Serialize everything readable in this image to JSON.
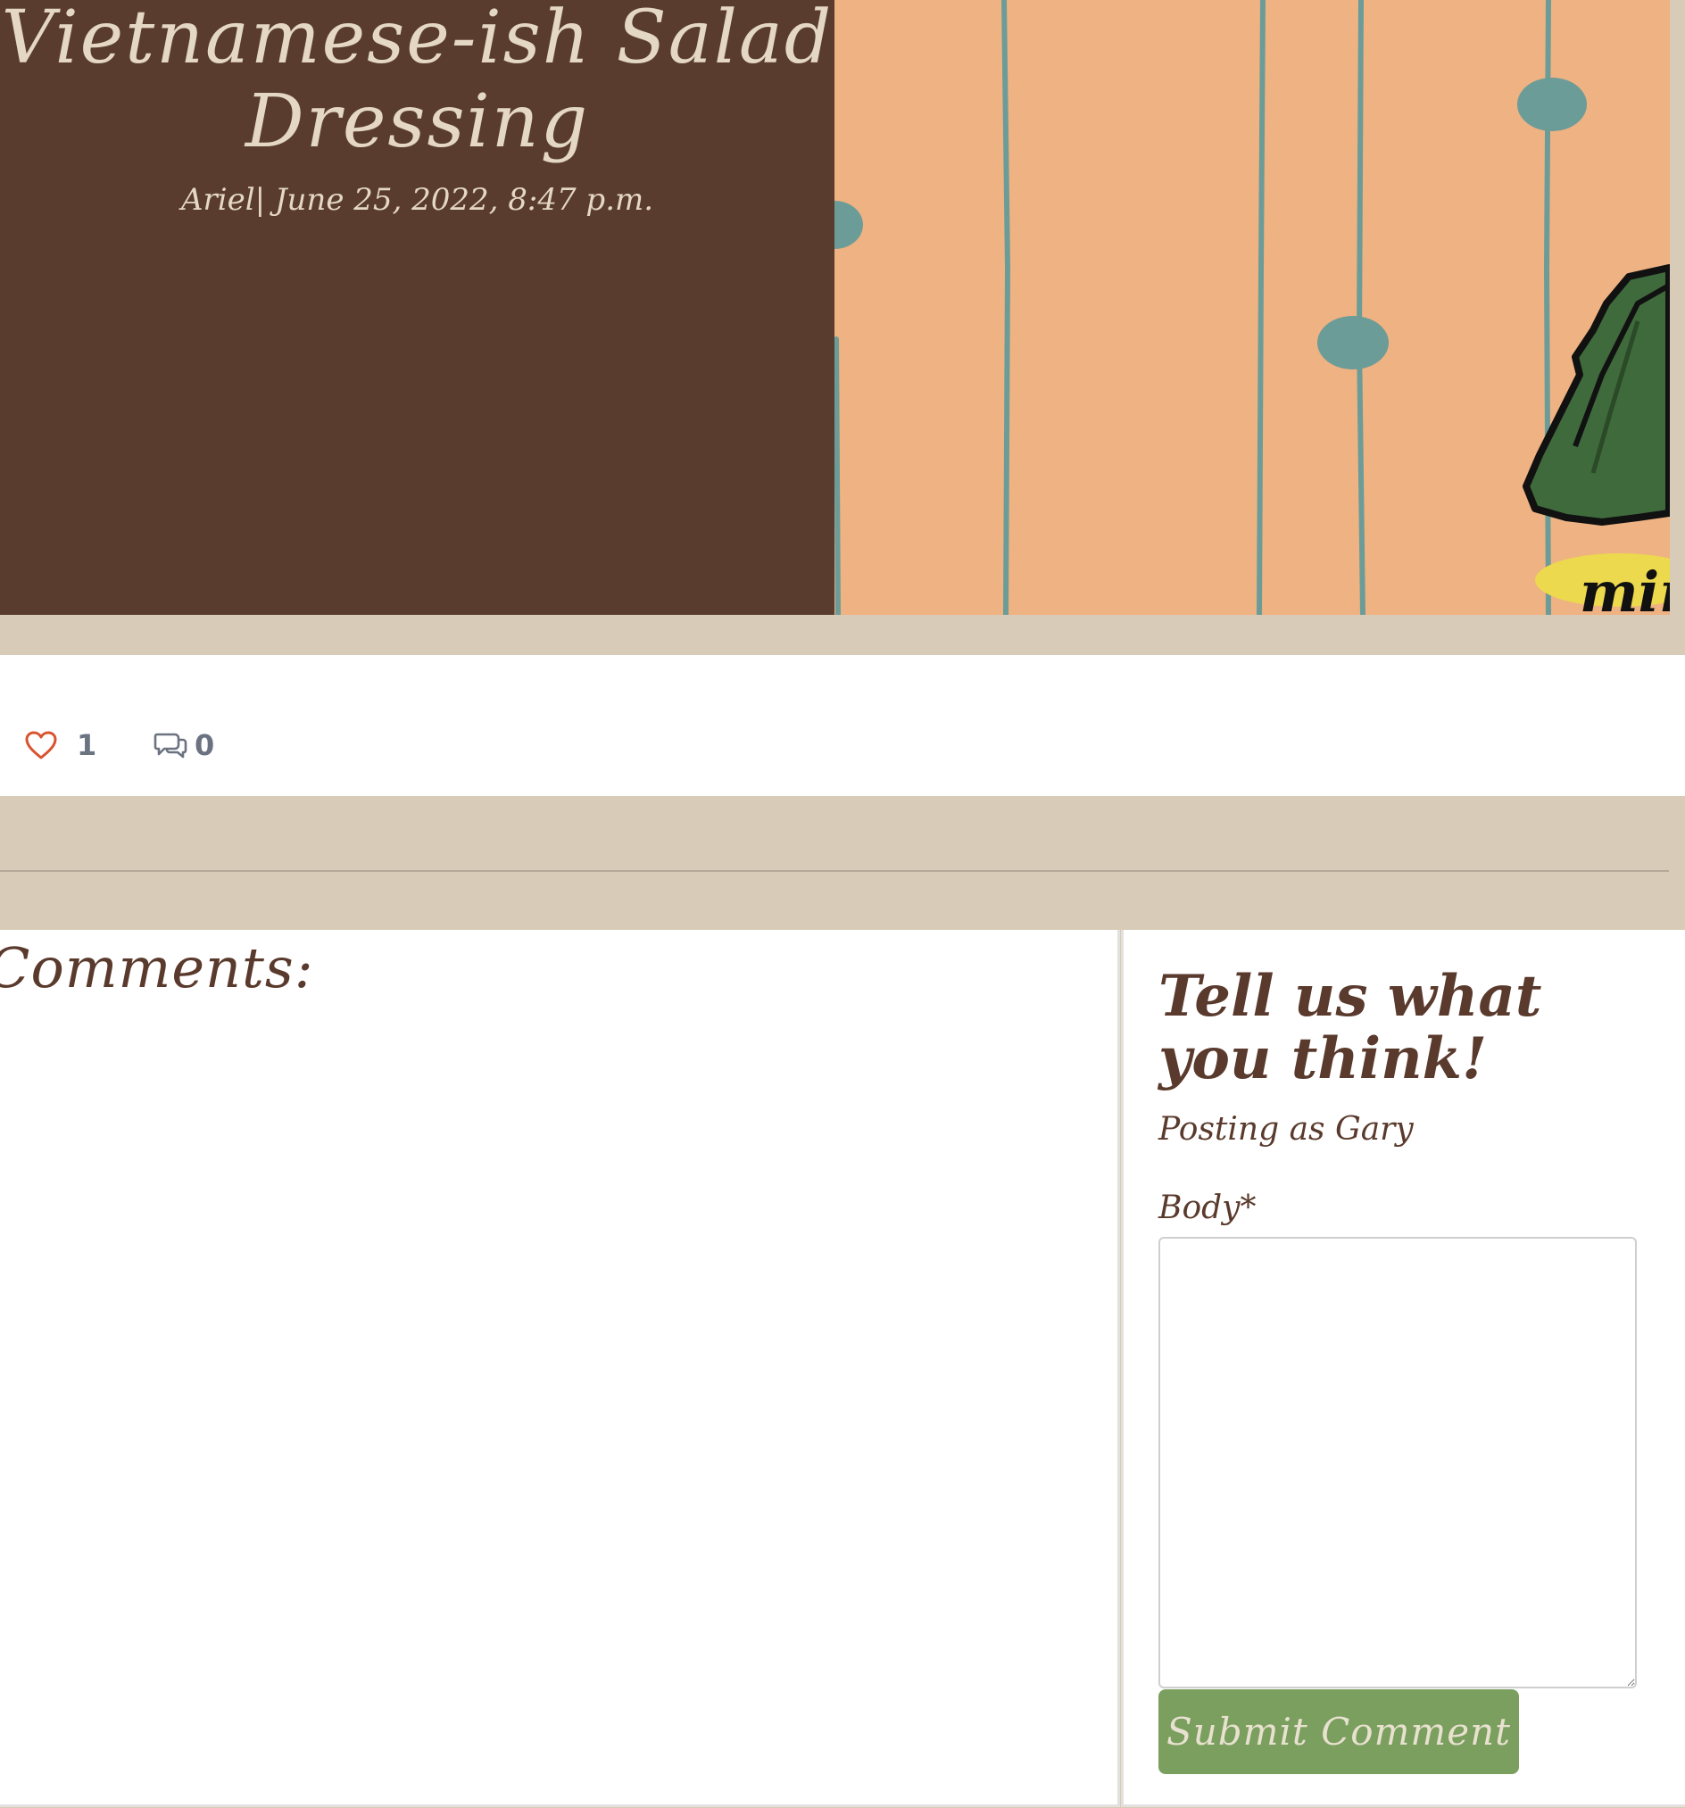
{
  "post": {
    "title": "Vietnamese-ish Salad Dressing",
    "meta": "Ariel| June 25, 2022, 8:47 p.m.",
    "image_label": "min"
  },
  "stats": {
    "likes": "1",
    "comments": "0",
    "like_icon": "heart-icon",
    "comment_icon": "comments-icon"
  },
  "comments": {
    "heading": "Comments:"
  },
  "form": {
    "heading": "Tell us what you think!",
    "posting_as": "Posting as Gary",
    "body_label": "Body*",
    "body_value": "",
    "submit_label": "Submit Comment"
  },
  "colors": {
    "hero_dark": "#593c2e",
    "hero_text": "#e4d7c3",
    "background": "#d8ccb8",
    "image_background": "#efb282",
    "heart": "#d9532f",
    "submit_button": "#7a9f5e"
  }
}
